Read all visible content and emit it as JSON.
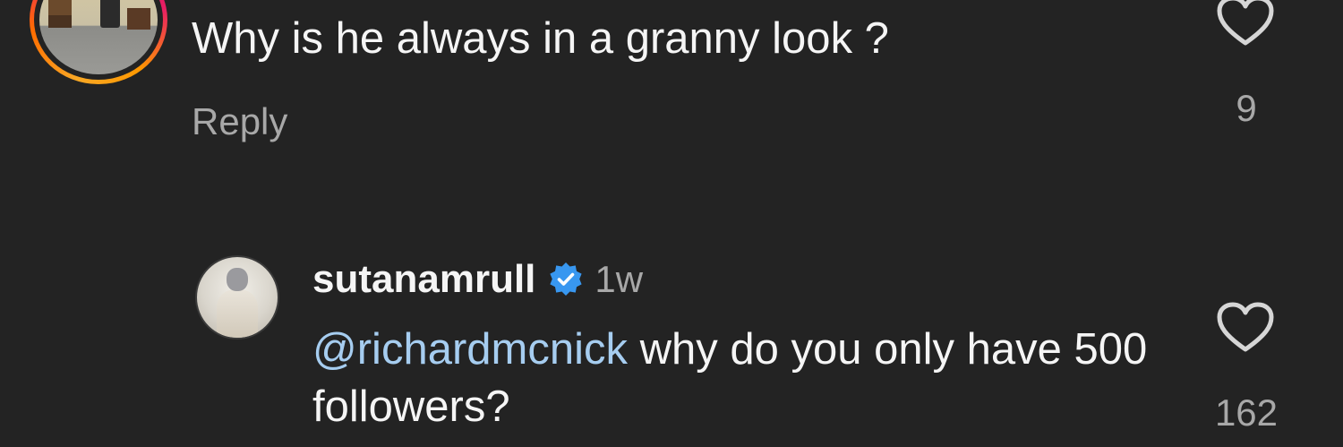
{
  "top_comment": {
    "text": "Why is he always in a granny look ?",
    "reply_label": "Reply",
    "like_count": "9"
  },
  "reply_comment": {
    "username": "sutanamrull",
    "timestamp": "1w",
    "mention": "@richardmcnick",
    "text": " why do you only have 500 followers?",
    "like_count": "162"
  },
  "colors": {
    "background": "#232323",
    "text": "#f5f5f5",
    "secondary_text": "#a8a8a8",
    "mention": "#a6cdf0",
    "verified_badge": "#3897f0"
  },
  "icons": {
    "like": "heart-outline-icon",
    "verified": "verified-badge-icon"
  }
}
